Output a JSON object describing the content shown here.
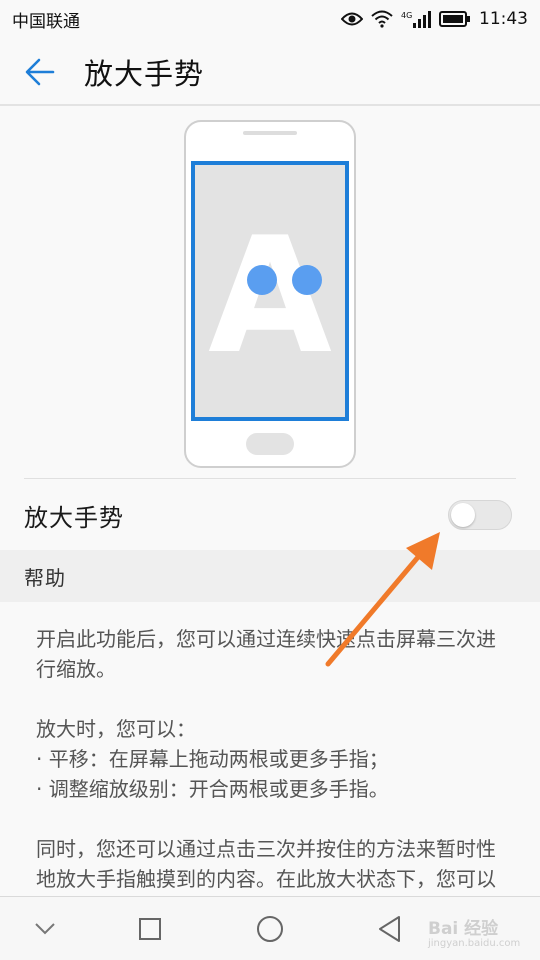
{
  "status_bar": {
    "carrier": "中国联通",
    "network": "4G",
    "time": "11:43"
  },
  "header": {
    "title": "放大手势"
  },
  "illustration": {
    "letter": "A"
  },
  "toggle": {
    "label": "放大手势",
    "state": "off"
  },
  "help": {
    "title": "帮助",
    "paragraphs": [
      "开启此功能后，您可以通过连续快速点击屏幕三次进行缩放。",
      "放大时，您可以：",
      "· 平移：在屏幕上拖动两根或更多手指；",
      "· 调整缩放级别：开合两根或更多手指。",
      "同时，您还可以通过点击三次并按住的方法来暂时性地放大手指触摸到的内容。在此放大状态下，您可以拖动手指查看屏幕上的各个部"
    ]
  },
  "watermark": {
    "brand": "Bai 经验",
    "url": "jingyan.baidu.com"
  },
  "colors": {
    "accent": "#1e7ed8",
    "annotation_arrow": "#f07a2a",
    "dots": "#5a9ef0"
  },
  "icons": {
    "back": "arrow-left-icon",
    "nav_back": "triangle-back-icon",
    "nav_home": "circle-home-icon",
    "nav_recent": "square-recent-icon",
    "nav_collapse": "chevron-down-icon"
  }
}
